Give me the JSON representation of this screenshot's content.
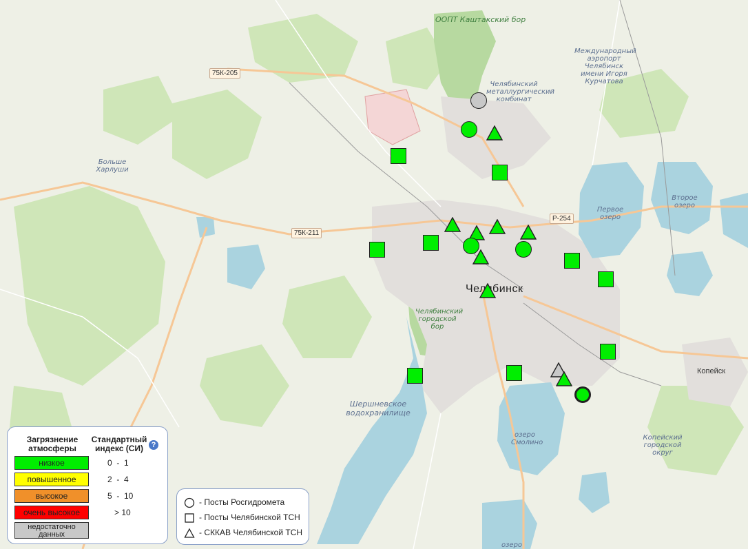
{
  "map": {
    "labels": {
      "kashtak": "ООПТ Каштакский бор",
      "metallurg": "Челябинский металлургический комбинат",
      "airport": "Международный аэропорт Челябинск имени Игоря Курчатова",
      "kharlushi": "Больше Харлуши",
      "lake1": "Первое озеро",
      "lake2": "Второе озеро",
      "city": "Челябинск",
      "gorodskoy_bor": "Челябинский городской бор",
      "sherhsnev": "Шершневское водохранилище",
      "smolino": "озеро Смолино",
      "kopeysk": "Копейск",
      "kopeysk_okrug": "Копейский городской округ",
      "ozero_bottom": "озеро"
    },
    "roads": {
      "r1": "75К-205",
      "r2": "75К-211",
      "r3": "Р-254"
    }
  },
  "stations": [
    {
      "shape": "circle",
      "status": "gray"
    },
    {
      "shape": "circle",
      "status": "green"
    },
    {
      "shape": "triangle",
      "status": "green"
    },
    {
      "shape": "square",
      "status": "green"
    },
    {
      "shape": "square",
      "status": "green"
    },
    {
      "shape": "triangle",
      "status": "green"
    },
    {
      "shape": "triangle",
      "status": "green"
    },
    {
      "shape": "triangle",
      "status": "green"
    },
    {
      "shape": "triangle",
      "status": "green"
    },
    {
      "shape": "square",
      "status": "green"
    },
    {
      "shape": "square",
      "status": "green"
    },
    {
      "shape": "circle",
      "status": "green"
    },
    {
      "shape": "circle",
      "status": "green"
    },
    {
      "shape": "triangle",
      "status": "green"
    },
    {
      "shape": "square",
      "status": "green"
    },
    {
      "shape": "square",
      "status": "green"
    },
    {
      "shape": "triangle",
      "status": "green"
    },
    {
      "shape": "square",
      "status": "green"
    },
    {
      "shape": "square",
      "status": "green"
    },
    {
      "shape": "square",
      "status": "green"
    },
    {
      "shape": "triangle",
      "status": "gray"
    },
    {
      "shape": "triangle",
      "status": "green"
    },
    {
      "shape": "circle",
      "status": "green"
    }
  ],
  "colors": {
    "green": "#00ee00",
    "gray": "#c8c8c8",
    "yellow": "#ffff00",
    "orange": "#f0902a",
    "red": "#ff0000"
  },
  "legend": {
    "col1_header": "Загрязнение атмосферы",
    "col2_header": "Стандартный индекс (СИ)",
    "help_icon": "?",
    "levels": [
      {
        "label": "низкое",
        "range": "0  -  1",
        "color": "#00ee00"
      },
      {
        "label": "повышенное",
        "range": "2  -  4",
        "color": "#ffff00"
      },
      {
        "label": "высокое",
        "range": "5  -  10",
        "color": "#f0902a"
      },
      {
        "label": "очень высокое",
        "range": "   > 10",
        "color": "#ff0000"
      },
      {
        "label": "недостаточно данных",
        "range": "",
        "color": "#c8c8c8"
      }
    ]
  },
  "shape_legend": {
    "circle": "- Посты Росгидромета",
    "square": "- Посты Челябинской ТСН",
    "triangle": "- СККАВ Челябинской ТСН"
  }
}
